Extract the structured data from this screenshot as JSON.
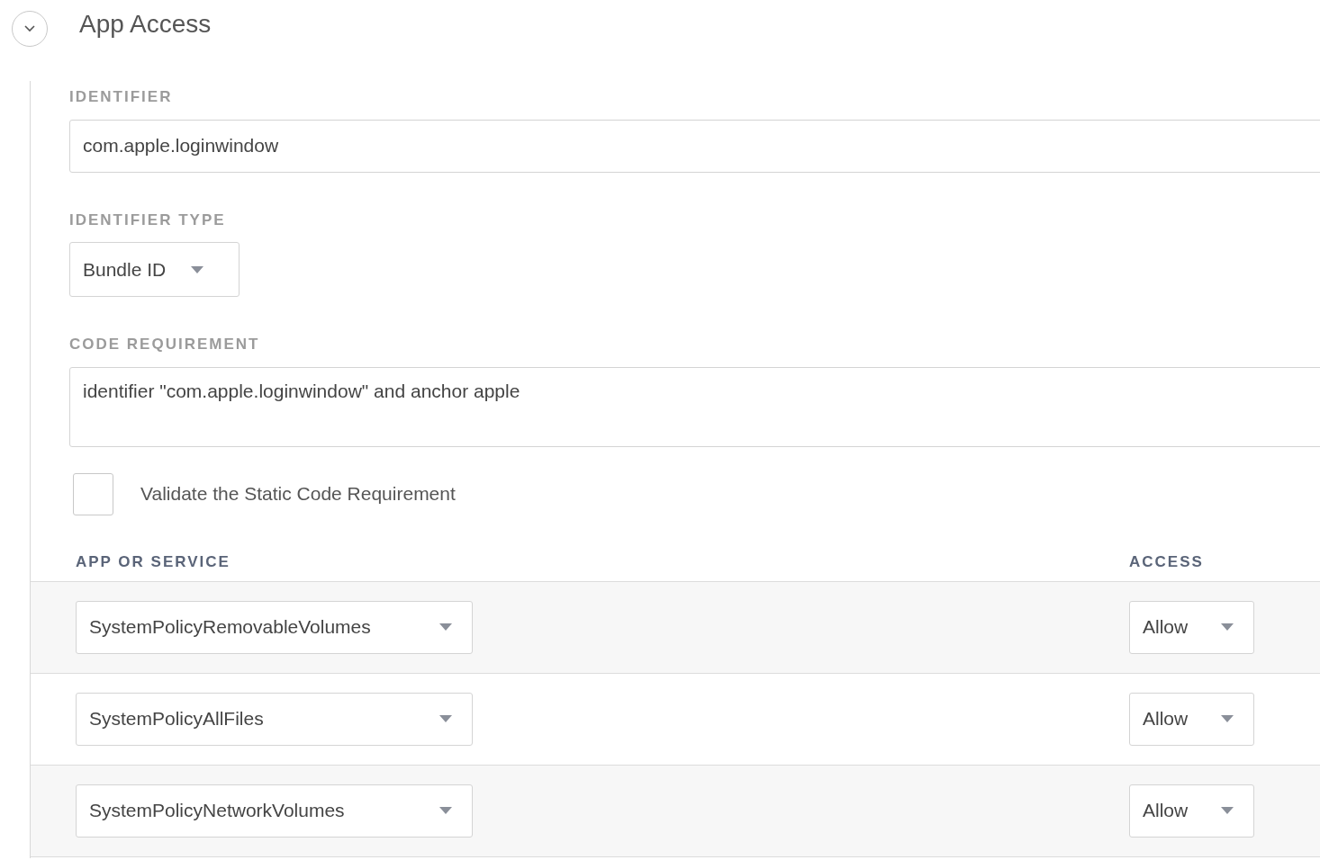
{
  "section": {
    "title": "App Access",
    "expanded": true
  },
  "fields": [
    {
      "kind": "text",
      "label": "IDENTIFIER",
      "value": "com.apple.loginwindow"
    },
    {
      "kind": "select",
      "label": "IDENTIFIER TYPE",
      "value": "Bundle ID"
    },
    {
      "kind": "textarea",
      "label": "CODE REQUIREMENT",
      "value": "identifier \"com.apple.loginwindow\" and anchor apple"
    }
  ],
  "checkbox": {
    "label": "Validate the Static Code Requirement",
    "checked": false
  },
  "table": {
    "columns": [
      "APP OR SERVICE",
      "ACCESS"
    ],
    "rows": [
      {
        "service": "SystemPolicyRemovableVolumes",
        "access": "Allow"
      },
      {
        "service": "SystemPolicyAllFiles",
        "access": "Allow"
      },
      {
        "service": "SystemPolicyNetworkVolumes",
        "access": "Allow"
      }
    ]
  }
}
